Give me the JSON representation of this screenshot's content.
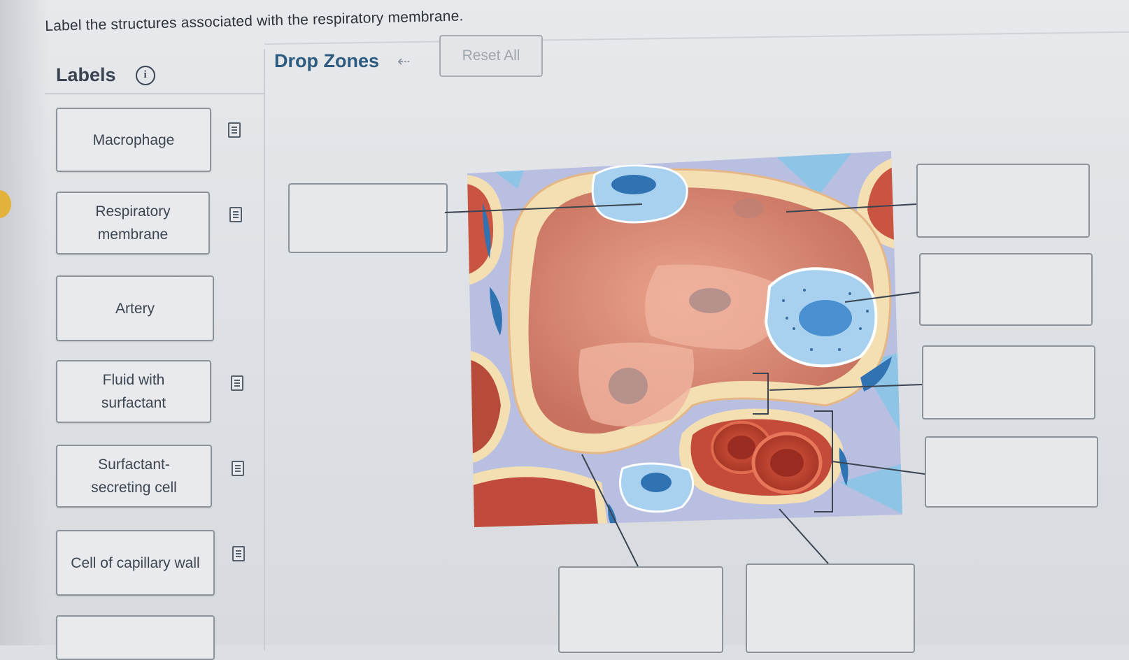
{
  "question": "Label the structures associated with the respiratory membrane.",
  "labels_panel": {
    "title": "Labels",
    "info_icon": "info-icon",
    "hint_icon": "hint-document-icon",
    "items": [
      {
        "label": "Macrophage"
      },
      {
        "label": "Respiratory membrane"
      },
      {
        "label": "Artery"
      },
      {
        "label": "Fluid with surfactant"
      },
      {
        "label": "Surfactant-secreting cell"
      },
      {
        "label": "Cell of capillary wall"
      }
    ]
  },
  "drop_panel": {
    "title": "Drop Zones",
    "undo_icon": "undo-arrow-icon",
    "reset_label": "Reset All"
  },
  "colors": {
    "title_blue": "#2d5b7f",
    "text": "#3c4550",
    "border": "#8c939b",
    "tissue_pink": "#d98a78",
    "tissue_cream": "#f3dfb2",
    "cell_blue": "#5a9fd3",
    "rbc_red": "#c5442e"
  }
}
